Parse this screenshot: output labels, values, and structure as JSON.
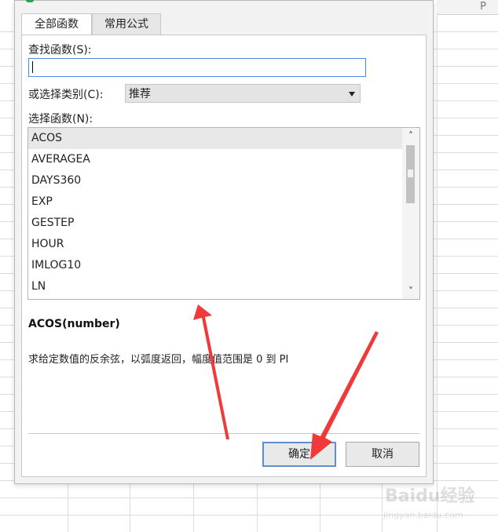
{
  "sheet": {
    "column_letter": "P"
  },
  "dialog": {
    "tabs": [
      {
        "label": "全部函数",
        "active": true
      },
      {
        "label": "常用公式",
        "active": false
      }
    ],
    "search": {
      "label": "查找函数(S):",
      "value": ""
    },
    "category": {
      "label": "或选择类别(C):",
      "selected": "推荐"
    },
    "function_list": {
      "label": "选择函数(N):",
      "items": [
        "ACOS",
        "AVERAGEA",
        "DAYS360",
        "EXP",
        "GESTEP",
        "HOUR",
        "IMLOG10",
        "LN"
      ],
      "selected_index": 0
    },
    "description": {
      "signature": "ACOS(number)",
      "text": "求给定数值的反余弦，以弧度返回，幅度值范围是 0 到 PI"
    },
    "buttons": {
      "ok": "确定",
      "cancel": "取消"
    }
  },
  "watermark": {
    "logo": "Baidu经验",
    "url": "jingyan.baidu.com"
  },
  "colors": {
    "annotation_arrow": "#f03a3a",
    "focus_border": "#4a8cd9"
  }
}
